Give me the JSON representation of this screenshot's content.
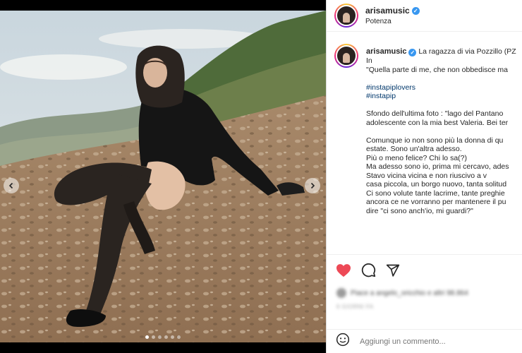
{
  "post": {
    "username": "arisamusic",
    "location": "Potenza",
    "verified_icon": "verified-badge-icon",
    "caption": {
      "lines": [
        "La ragazza di via Pozzillo (PZ",
        "In",
        "\"Quella parte di me, che non obbedisce ma"
      ],
      "hashtags": [
        "#instapiplovers",
        "#instapip"
      ],
      "paragraph_1": [
        "Sfondo dell'ultima foto : \"lago del Pantano",
        "adolescente con la mia best Valeria. Bei ter"
      ],
      "paragraph_2": [
        "Comunque io non sono più la donna di qu",
        "estate. Sono un'altra adesso.",
        "Più o meno felice? Chi lo sa(?)",
        "Ma adesso sono io, prima mi cercavo, ades",
        "Stavo vicina vicina e non riuscivo a v",
        "casa piccola, un borgo nuovo, tanta solitud",
        "Ci sono volute tante lacrime, tante preghie",
        "ancora ce ne vorranno per mantenere il pu",
        "dire \"ci sono anch'io, mi guardi?\""
      ]
    },
    "blurred_comment": {
      "text": "Piace a angelo_oricchio e altri 98.864",
      "date": "6 GIORNI FA"
    },
    "comment_placeholder": "Aggiungi un commento...",
    "carousel": {
      "slide_count": 6,
      "active_index": 0
    },
    "icons": [
      "heart-icon",
      "comment-icon",
      "share-icon",
      "emoji-icon",
      "chevron-left-icon",
      "chevron-right-icon"
    ],
    "colors": {
      "like": "#ed4956",
      "hashtag": "#00376b",
      "verified": "#3897f0",
      "text": "#262626",
      "muted": "#8e8e8e"
    }
  }
}
